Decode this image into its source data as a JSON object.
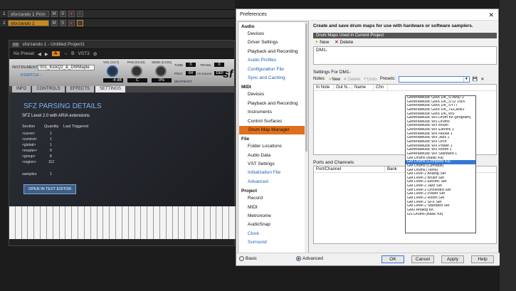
{
  "tracks": [
    {
      "num": "1",
      "name": "sforzando 1 Prim",
      "active": false
    },
    {
      "num": "2",
      "name": "sforzando 1",
      "active": true
    }
  ],
  "track_buttons": [
    "M",
    "S"
  ],
  "sfz": {
    "title": "sforzando 1 - Untitled Project1",
    "preset": "No Preset",
    "ab": "A",
    "b": "B",
    "vst": "VST3",
    "instrument_label": "INSTRUMENT:",
    "instrument": "001_KickQ2_&_DWMaple",
    "keyswitch": "KSWITCH -",
    "vol_label": "VOL (CC7)",
    "pan_label": "PAN (CC10)",
    "send_label": "SEND (CC91)",
    "vol_value": "-4 dB",
    "pan_value": "C",
    "send_value": "0%",
    "tune_label": "TUNE",
    "tune_value": "0",
    "trans_label": "TRANS.",
    "trans_value": "0",
    "poly_label": "POLY",
    "poly_value": "64",
    "pitch_label": "PB RANGE",
    "pitch_value": "DEF",
    "snapshot_label": "SNAPSHOT",
    "logo": "sf",
    "tabs": [
      "INFO",
      "CONTROLS",
      "EFFECTS",
      "SETTINGS"
    ],
    "heading": "SFZ PARSING DETAILS",
    "level": "SFZ Level 2.0 with ARIA extensions",
    "cols": [
      "Section",
      "Quantity",
      "Last Triggered"
    ],
    "rows": [
      [
        "<curve>",
        "1"
      ],
      [
        "<control>",
        "1"
      ],
      [
        "<global>",
        "1"
      ],
      [
        "<master>",
        "9"
      ],
      [
        "<group>",
        "8"
      ],
      [
        "<region>",
        "112"
      ]
    ],
    "samples_label": "samples",
    "samples_value": "1",
    "open_button": "OPEN IN TEXT EDITOR"
  },
  "prefs": {
    "title": "Preferences",
    "close": "✕",
    "tree": [
      {
        "type": "cat",
        "label": "Audio"
      },
      {
        "type": "item",
        "label": "Devices"
      },
      {
        "type": "item",
        "label": "Driver Settings"
      },
      {
        "type": "item",
        "label": "Playback and Recording"
      },
      {
        "type": "item",
        "label": "Audio Profiles",
        "blue": true
      },
      {
        "type": "item",
        "label": "Configuration File",
        "blue": true
      },
      {
        "type": "item",
        "label": "Sync and Caching",
        "blue": true
      },
      {
        "type": "cat",
        "label": "MIDI"
      },
      {
        "type": "item",
        "label": "Devices"
      },
      {
        "type": "item",
        "label": "Playback and Recording"
      },
      {
        "type": "item",
        "label": "Instruments"
      },
      {
        "type": "item",
        "label": "Control Surfaces"
      },
      {
        "type": "item",
        "label": "Drum Map Manager",
        "sel": true
      },
      {
        "type": "cat",
        "label": "File"
      },
      {
        "type": "item",
        "label": "Folder Locations"
      },
      {
        "type": "item",
        "label": "Audio Data"
      },
      {
        "type": "item",
        "label": "VST Settings"
      },
      {
        "type": "item",
        "label": "Initialization File",
        "blue": true
      },
      {
        "type": "item",
        "label": "Advanced",
        "blue": true
      },
      {
        "type": "cat",
        "label": "Project"
      },
      {
        "type": "item",
        "label": "Record"
      },
      {
        "type": "item",
        "label": "MIDI"
      },
      {
        "type": "item",
        "label": "Metronome"
      },
      {
        "type": "item",
        "label": "AudioSnap"
      },
      {
        "type": "item",
        "label": "Clock",
        "blue": true
      },
      {
        "type": "item",
        "label": "Surround",
        "blue": true
      }
    ],
    "header": "Create and save drum maps for use with hardware or software samplers.",
    "section_maps": "Drum Maps Used in Current Project",
    "new": "New",
    "delete": "Delete",
    "map_entry": "DM1-",
    "settings_for": "Settings For DM1-",
    "notes_label": "Notes:",
    "notes_new": "New",
    "notes_delete": "Delete",
    "notes_undo": "Undo",
    "presets_label": "Presets:",
    "table_cols": [
      "In Note",
      "Out N...",
      "Name",
      "Chn"
    ],
    "ports_label": "Ports and Channels",
    "port_cols": [
      "Port/Channel",
      "Bank"
    ],
    "presets": [
      "GeneralMusic GMX DK_STAND 2",
      "GeneralMusic GMX DK_STD 1WX",
      "GeneralMusic GMX DK_SY77",
      "GeneralMusic GMX DK_TECHNO",
      "GeneralMusic GMX DK_WS",
      "GeneralMusic WS Drum Kit (program)",
      "GeneralMusic WS Drums",
      "GeneralMusic WX Brush",
      "GeneralMusic WX Electric 1",
      "GeneralMusic WX House 1",
      "GeneralMusic WX Jazz 1",
      "GeneralMusic WX Orch",
      "GeneralMusic WX Power 1",
      "GeneralMusic WX Room 1",
      "GeneralMusic WX Standard 1",
      "GM Drums (Basic Kit)",
      "GM Drums (Complete Kit)",
      "GM Drums (Cymbals)",
      "GM Drums (Toms)",
      "GM Level 2 Analog Set",
      "GM Level 2 Brush Set",
      "GM Level 2 Electric Set",
      "GM Level 2 Jazz Set",
      "GM Level 2 Orchestra Set",
      "GM Level 2 Power Set",
      "GM Level 2 Room Set",
      "GM Level 2 SFX Set",
      "GM Level 2 Standard Set",
      "GM2 Analog Kit",
      "GS Drums (Basic Kit)"
    ],
    "preset_highlight": "GM Drums (Complete Kit)",
    "basic": "Basic",
    "advanced": "Advanced",
    "ok": "OK",
    "cancel": "Cancel",
    "apply": "Apply",
    "help": "Help"
  }
}
